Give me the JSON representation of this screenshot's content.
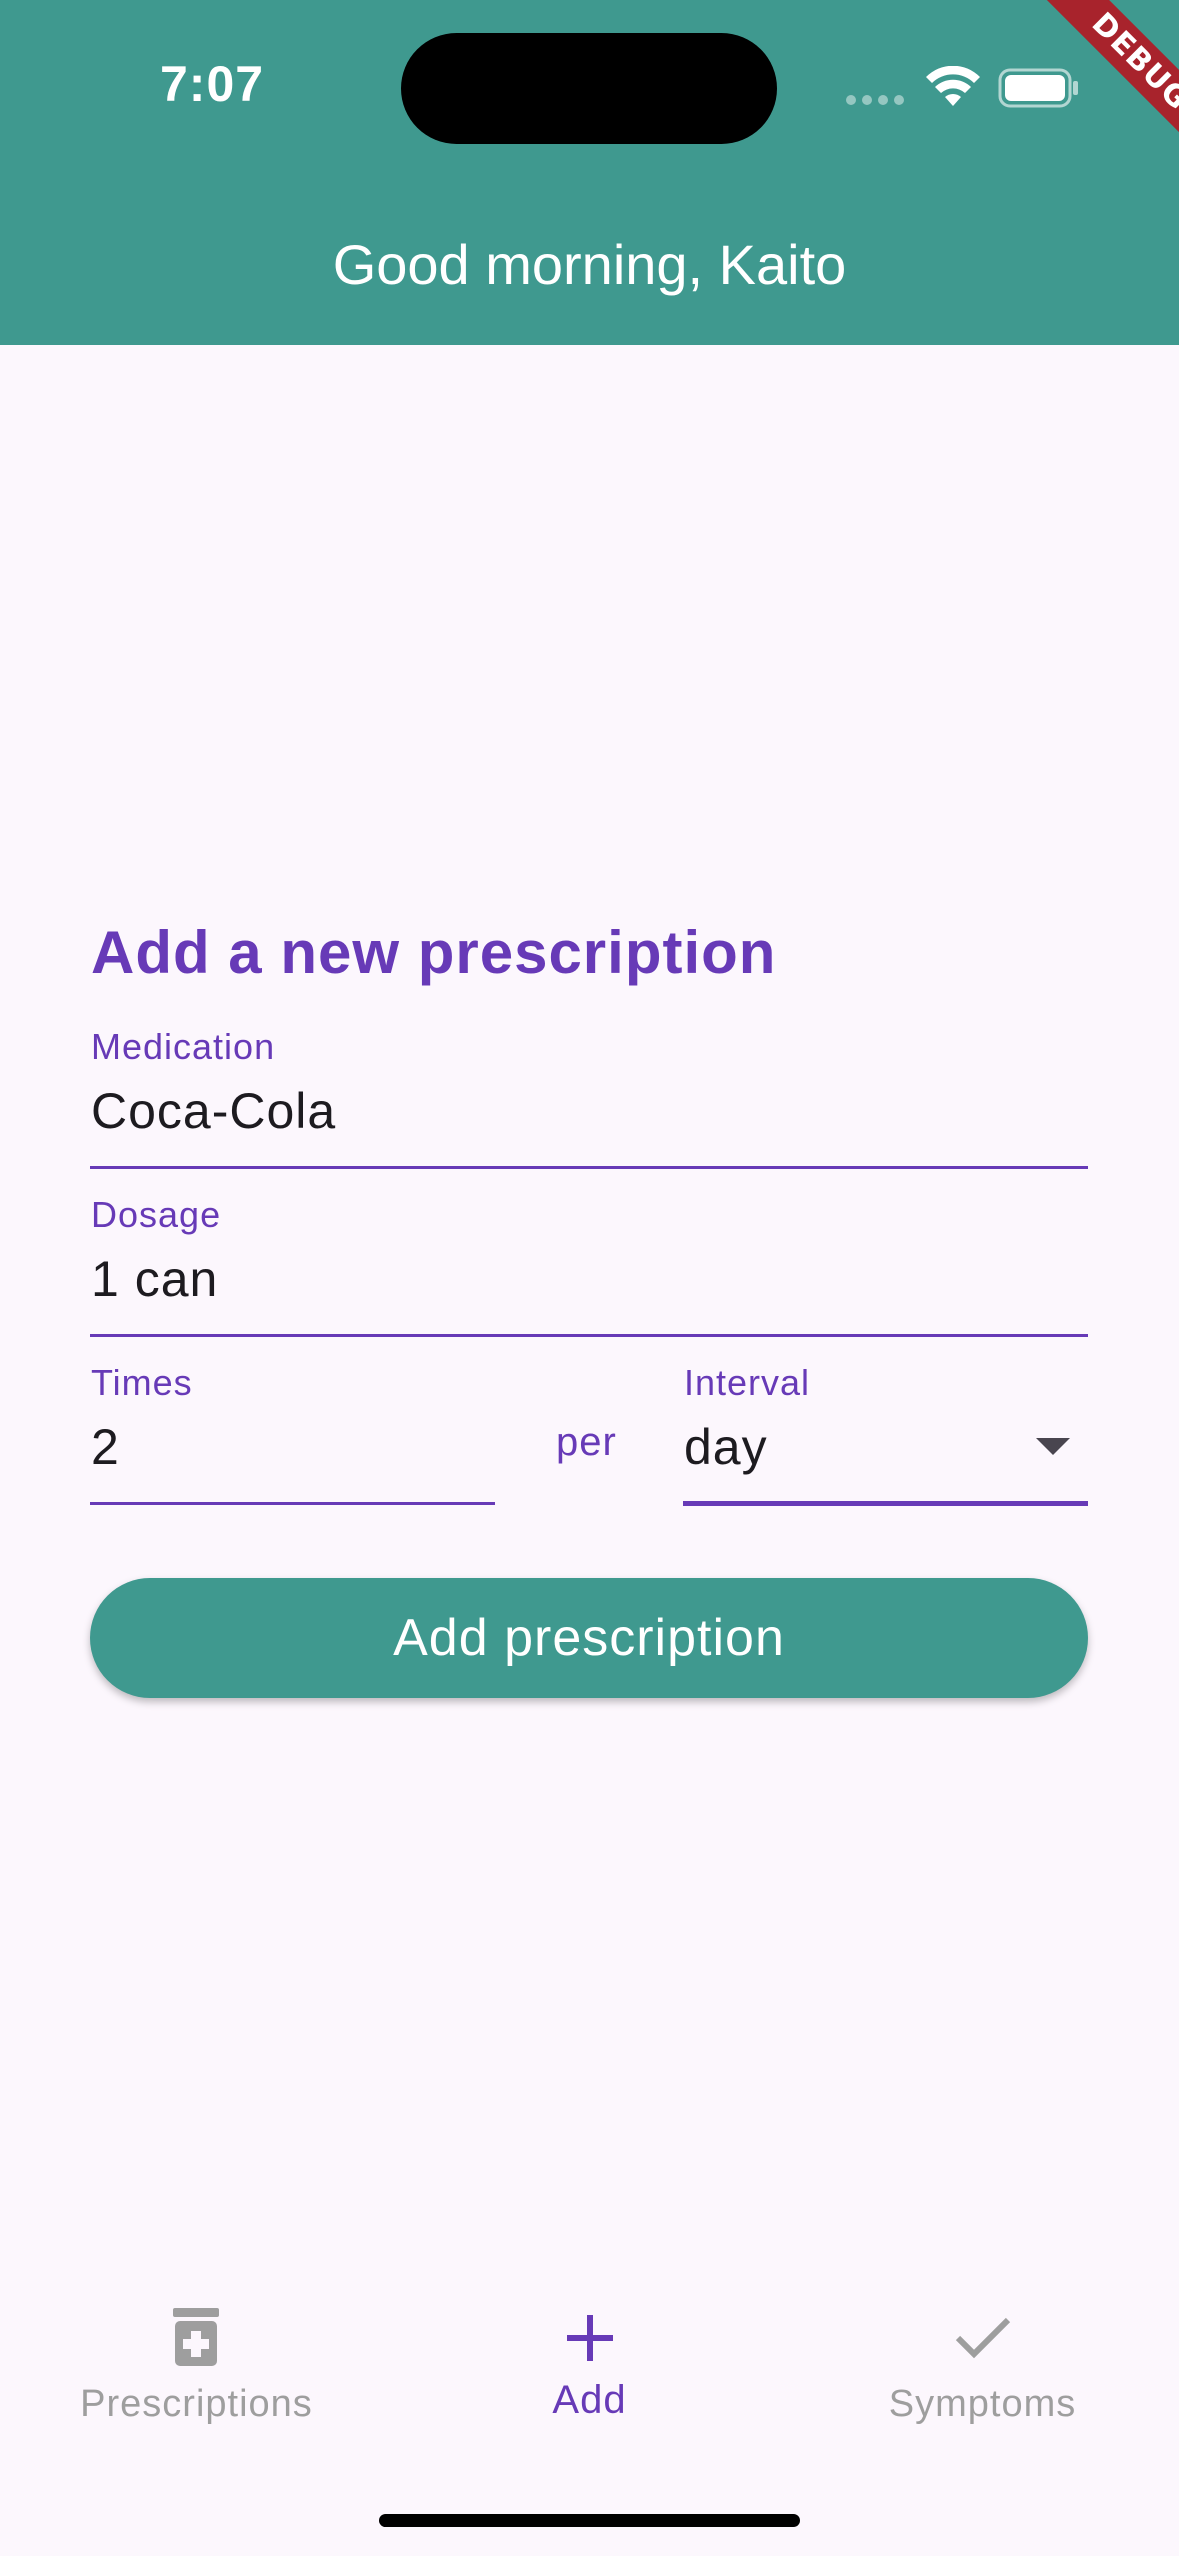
{
  "status_bar": {
    "time": "7:07",
    "icons": [
      "signal-dots-icon",
      "wifi-icon",
      "battery-icon"
    ]
  },
  "debug_banner": "DEBUG",
  "app_bar": {
    "title": "Good morning, Kaito",
    "background": "#3f998f"
  },
  "form": {
    "heading": "Add a new prescription",
    "medication": {
      "label": "Medication",
      "value": "Coca-Cola"
    },
    "dosage": {
      "label": "Dosage",
      "value": "1 can"
    },
    "times": {
      "label": "Times",
      "value": "2"
    },
    "per_text": "per",
    "interval": {
      "label": "Interval",
      "value": "day"
    },
    "submit_label": "Add prescription"
  },
  "colors": {
    "accent": "#673ab7",
    "primary": "#3f998f",
    "background": "#fcf7fd",
    "inactive": "#9e9e9e"
  },
  "bottom_nav": {
    "items": [
      {
        "label": "Prescriptions",
        "icon": "medicine-bottle-icon",
        "active": false
      },
      {
        "label": "Add",
        "icon": "plus-icon",
        "active": true
      },
      {
        "label": "Symptoms",
        "icon": "checkmark-icon",
        "active": false
      }
    ]
  }
}
